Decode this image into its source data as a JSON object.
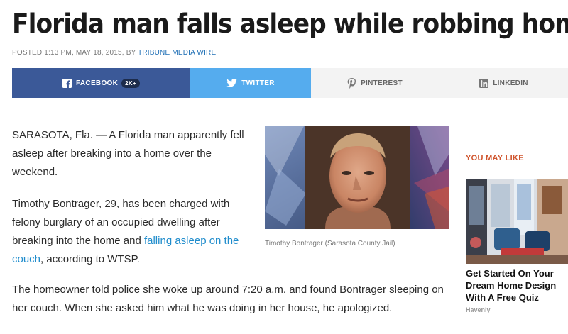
{
  "article": {
    "headline": "Florida man falls asleep while robbing home",
    "byline_prefix": "POSTED 1:13 PM, MAY 18, 2015, BY ",
    "byline_author": "TRIBUNE MEDIA WIRE",
    "paragraphs": {
      "p1": "SARASOTA, Fla. — A Florida man apparently fell asleep after breaking into a home over the weekend.",
      "p2_before": "Timothy Bontrager, 29, has been charged with felony burglary of an occupied dwelling after breaking into the home and ",
      "p2_link": "falling asleep on the couch",
      "p2_after": ", according to WTSP.",
      "p3": "The homeowner told police she woke up around 7:20 a.m. and found Bontrager sleeping on her couch. When she asked him what he was doing in her house, he apologized."
    },
    "photo_caption": "Timothy Bontrager (Sarasota County Jail)"
  },
  "share": {
    "facebook_label": "FACEBOOK",
    "facebook_count": "2K+",
    "twitter_label": "TWITTER",
    "pinterest_label": "PINTEREST",
    "linkedin_label": "LINKEDIN"
  },
  "sidebar": {
    "heading": "YOU MAY LIKE",
    "promo_title": "Get Started On Your Dream Home Design With A Free Quiz",
    "promo_source": "Havenly"
  },
  "colors": {
    "facebook": "#3b5998",
    "twitter": "#55acee",
    "link": "#1f8ccc",
    "sidebar_heading": "#d0552e"
  },
  "icons": [
    "facebook-icon",
    "twitter-icon",
    "pinterest-icon",
    "linkedin-icon"
  ]
}
